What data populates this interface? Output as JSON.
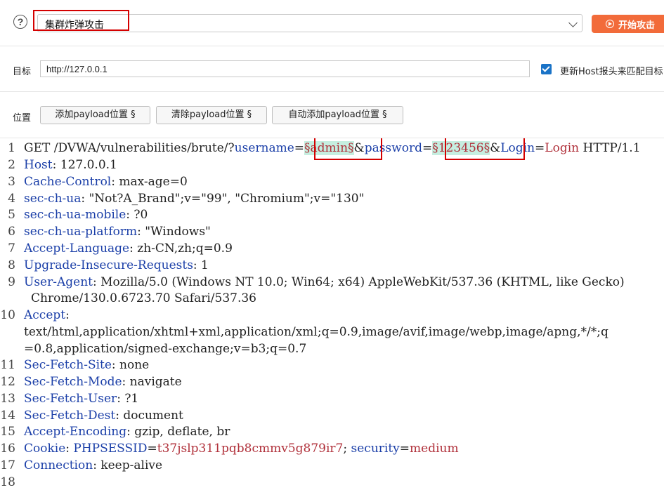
{
  "toolbar": {
    "help_icon": "question-icon",
    "attack_type": "集群炸弹攻击",
    "start_button": "开始攻击"
  },
  "target": {
    "label": "目标",
    "url": "http://127.0.0.1",
    "host_checkbox_checked": true,
    "host_label": "更新Host报头来匹配目标"
  },
  "positions": {
    "label": "位置",
    "add_button": "添加payload位置 §",
    "clear_button": "清除payload位置 §",
    "auto_button": "自动添加payload位置 §"
  },
  "request": {
    "line_numbers": [
      "1",
      "2",
      "3",
      "4",
      "5",
      "6",
      "7",
      "8",
      "9",
      "10",
      "11",
      "12",
      "13",
      "14",
      "15",
      "16",
      "17",
      "18"
    ],
    "l1": {
      "method": "GET ",
      "path": "/DVWA/vulnerabilities/brute/?",
      "p1": "username",
      "eq1": "=",
      "payload1": "§admin§",
      "amp1": "&",
      "p2": "password",
      "eq2": "=",
      "payload2": "§123456§",
      "amp2": "&",
      "p3": "Login",
      "eq3": "=",
      "v3": "Login",
      "proto": " HTTP/1.1"
    },
    "headers": [
      {
        "k": "Host",
        "v": ": 127.0.0.1"
      },
      {
        "k": "Cache-Control",
        "v": ": max-age=0"
      },
      {
        "k": "sec-ch-ua",
        "v": ": \"Not?A_Brand\";v=\"99\", \"Chromium\";v=\"130\""
      },
      {
        "k": "sec-ch-ua-mobile",
        "v": ": ?0"
      },
      {
        "k": "sec-ch-ua-platform",
        "v": ": \"Windows\""
      },
      {
        "k": "Accept-Language",
        "v": ": zh-CN,zh;q=0.9"
      },
      {
        "k": "Upgrade-Insecure-Requests",
        "v": ": 1"
      },
      {
        "k": "User-Agent",
        "v": ": Mozilla/5.0 (Windows NT 10.0; Win64; x64) AppleWebKit/537.36 (KHTML, like Gecko)"
      }
    ],
    "ua_cont": "Chrome/130.0.6723.70 Safari/537.36",
    "accept_key": "Accept",
    "accept_colon": ":",
    "accept_v1": "text/html,application/xhtml+xml,application/xml;q=0.9,image/avif,image/webp,image/apng,*/*;q",
    "accept_v2": "=0.8,application/signed-exchange;v=b3;q=0.7",
    "headers2": [
      {
        "k": "Sec-Fetch-Site",
        "v": ": none"
      },
      {
        "k": "Sec-Fetch-Mode",
        "v": ": navigate"
      },
      {
        "k": "Sec-Fetch-User",
        "v": ": ?1"
      },
      {
        "k": "Sec-Fetch-Dest",
        "v": ": document"
      },
      {
        "k": "Accept-Encoding",
        "v": ": gzip, deflate, br"
      }
    ],
    "cookie": {
      "k": "Cookie",
      "colon": ": ",
      "n1": "PHPSESSID",
      "eq1": "=",
      "v1": "t37jslp311pqb8cmmv5g879ir7",
      "sep": "; ",
      "n2": "security",
      "eq2": "=",
      "v2": "medium"
    },
    "connection": {
      "k": "Connection",
      "v": ": keep-alive"
    }
  }
}
